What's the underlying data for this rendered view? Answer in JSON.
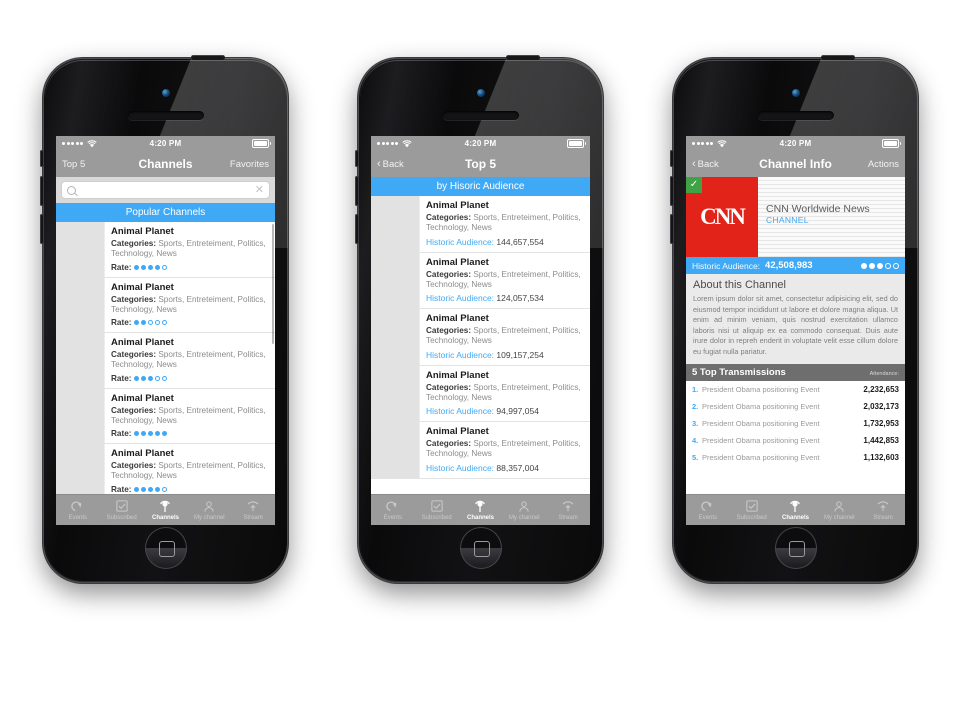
{
  "statusbar": {
    "time": "4:20 PM",
    "signal_dots": 5
  },
  "phone1": {
    "navbar": {
      "left": "Top 5",
      "title": "Channels",
      "right": "Favorites"
    },
    "search": {
      "value": "",
      "placeholder": ""
    },
    "section_header": "Popular Channels",
    "items": [
      {
        "title": "Animal Planet",
        "categories_label": "Categories:",
        "categories": " Sports, Entreteiment, Politics, Technology, News",
        "rate_label": "Rate:",
        "rating": 4
      },
      {
        "title": "Animal Planet",
        "categories_label": "Categories:",
        "categories": " Sports, Entreteiment, Politics, Technology, News",
        "rate_label": "Rate:",
        "rating": 2
      },
      {
        "title": "Animal Planet",
        "categories_label": "Categories:",
        "categories": " Sports, Entreteiment, Politics, Technology, News",
        "rate_label": "Rate:",
        "rating": 3
      },
      {
        "title": "Animal Planet",
        "categories_label": "Categories:",
        "categories": " Sports, Entreteiment, Politics, Technology, News",
        "rate_label": "Rate:",
        "rating": 5
      },
      {
        "title": "Animal Planet",
        "categories_label": "Categories:",
        "categories": " Sports, Entreteiment, Politics, Technology, News",
        "rate_label": "Rate:",
        "rating": 4
      }
    ]
  },
  "phone2": {
    "navbar": {
      "left": "Back",
      "title": "Top 5",
      "right": ""
    },
    "section_header": "by Hisoric Audience",
    "items": [
      {
        "title": "Animal Planet",
        "categories_label": "Categories:",
        "categories": " Sports, Entreteiment, Politics, Technology, News",
        "audience_label": "Historic Audience:",
        "audience": " 144,657,554"
      },
      {
        "title": "Animal Planet",
        "categories_label": "Categories:",
        "categories": " Sports, Entreteiment, Politics, Technology, News",
        "audience_label": "Historic Audience:",
        "audience": " 124,057,534"
      },
      {
        "title": "Animal Planet",
        "categories_label": "Categories:",
        "categories": " Sports, Entreteiment, Politics, Technology, News",
        "audience_label": "Historic Audience:",
        "audience": " 109,157,254"
      },
      {
        "title": "Animal Planet",
        "categories_label": "Categories:",
        "categories": " Sports, Entreteiment, Politics, Technology, News",
        "audience_label": "Historic Audience:",
        "audience": " 94,997,054"
      },
      {
        "title": "Animal Planet",
        "categories_label": "Categories:",
        "categories": " Sports, Entreteiment, Politics, Technology, News",
        "audience_label": "Historic Audience:",
        "audience": " 88,357,004"
      }
    ]
  },
  "phone3": {
    "navbar": {
      "left": "Back",
      "title": "Channel Info",
      "right": "Actions"
    },
    "card": {
      "logo_text": "CNN",
      "check": "✓",
      "name": "CNN Worldwide News",
      "sub": "CHANNEL"
    },
    "audience_bar": {
      "label": "Historic Audience:",
      "value": "42,508,983",
      "rating": 3,
      "rating_max": 5
    },
    "about": {
      "title": "About this Channel",
      "text": "Lorem ipsum dolor sit amet, consectetur  adipisicing elit, sed do eiusmod tempor incididunt ut labore et dolore magna aliqua. Ut enim ad minim veniam, quis nostrud exercitation ullamco laboris nisi ut aliquip ex ea commodo consequat. Duis aute irure dolor in repreh enderit in voluptate velit esse cillum dolore eu fugiat nulla pariatur."
    },
    "transmissions": {
      "title": "5 Top Transmissions",
      "column_right": "Attendance:",
      "rows": [
        {
          "n": "1.",
          "name": "President Obama positioning Event",
          "value": "2,232,653"
        },
        {
          "n": "2.",
          "name": "President Obama positioning Event",
          "value": "2,032,173"
        },
        {
          "n": "3.",
          "name": "President Obama positioning Event",
          "value": "1,732,953"
        },
        {
          "n": "4.",
          "name": "President Obama positioning Event",
          "value": "1,442,853"
        },
        {
          "n": "5.",
          "name": "President Obama positioning Event",
          "value": "1,132,603"
        }
      ]
    }
  },
  "tabbar": {
    "items": [
      {
        "label": "Events",
        "icon": "events-icon",
        "active": false
      },
      {
        "label": "Subscribed",
        "icon": "checkbox-icon",
        "active": false
      },
      {
        "label": "Channels",
        "icon": "broadcast-icon",
        "active": true
      },
      {
        "label": "My channel",
        "icon": "person-icon",
        "active": false
      },
      {
        "label": "Stream",
        "icon": "upload-wifi-icon",
        "active": false
      }
    ]
  },
  "colors": {
    "accent": "#3FA9F5",
    "chrome": "#9b9b9b",
    "brand_red": "#E2231A",
    "check_green": "#3FA346"
  }
}
